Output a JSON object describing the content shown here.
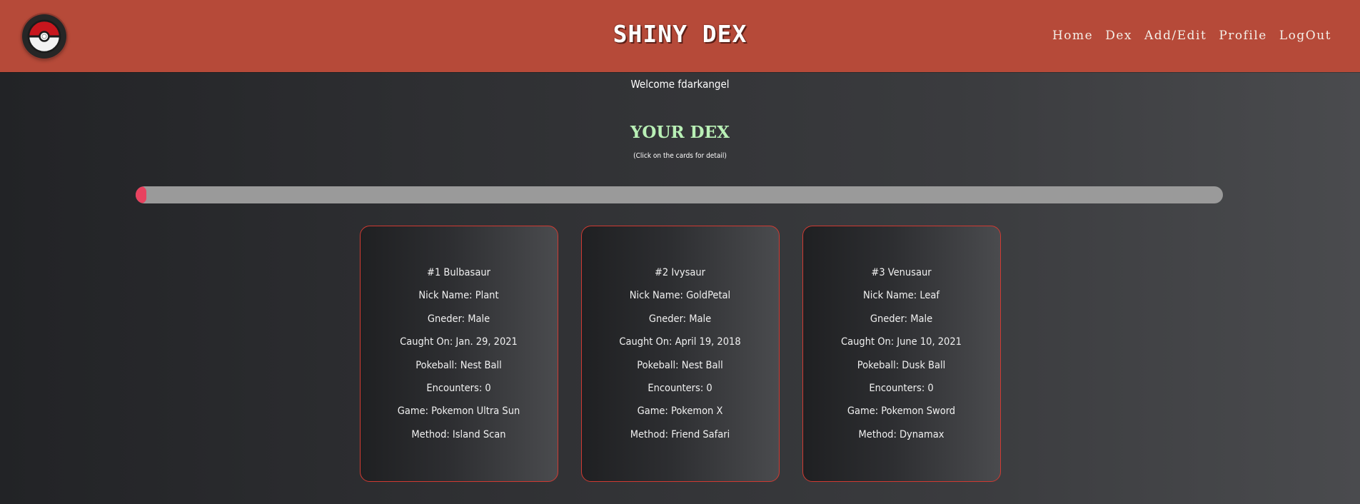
{
  "header": {
    "brand": "SHINY DEX",
    "logo_icon": "pokeball-icon",
    "background_color": "#b64a39",
    "nav": [
      {
        "label": "Home"
      },
      {
        "label": "Dex"
      },
      {
        "label": "Add/Edit"
      },
      {
        "label": "Profile"
      },
      {
        "label": "LogOut"
      }
    ]
  },
  "main": {
    "welcome": "Welcome fdarkangel",
    "title": "YOUR DEX",
    "title_color": "#b9f0b6",
    "subtitle": "(Click on the cards for detail)",
    "progress": {
      "value_fraction": 0.01,
      "fill_color": "#e8425f",
      "track_color": "#9a9a9a"
    }
  },
  "cards": [
    {
      "name": "#1 Bulbasaur",
      "nickname": "Nick Name: Plant",
      "gender": "Gneder: Male",
      "caught": "Caught On: Jan. 29, 2021",
      "pokeball": "Pokeball: Nest Ball",
      "encounters": "Encounters: 0",
      "game": "Game: Pokemon Ultra Sun",
      "method": "Method: Island Scan"
    },
    {
      "name": "#2 Ivysaur",
      "nickname": "Nick Name: GoldPetal",
      "gender": "Gneder: Male",
      "caught": "Caught On: April 19, 2018",
      "pokeball": "Pokeball: Nest Ball",
      "encounters": "Encounters: 0",
      "game": "Game: Pokemon X",
      "method": "Method: Friend Safari"
    },
    {
      "name": "#3 Venusaur",
      "nickname": "Nick Name: Leaf",
      "gender": "Gneder: Male",
      "caught": "Caught On: June 10, 2021",
      "pokeball": "Pokeball: Dusk Ball",
      "encounters": "Encounters: 0",
      "game": "Game: Pokemon Sword",
      "method": "Method: Dynamax"
    }
  ]
}
